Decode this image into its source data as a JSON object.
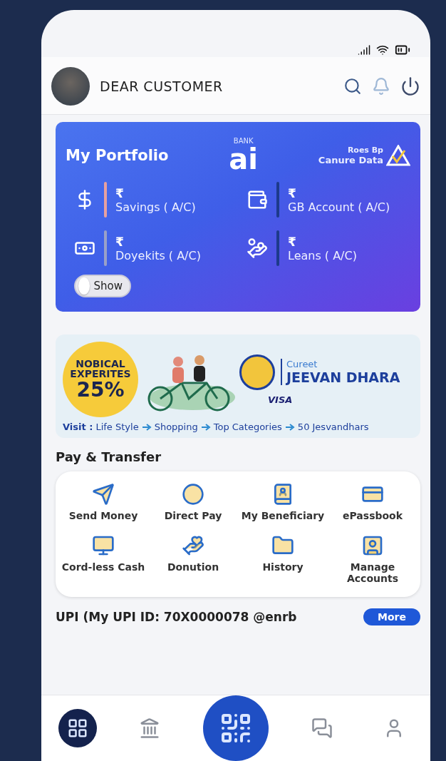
{
  "header": {
    "greeting": "DEAR CUSTOMER"
  },
  "portfolio": {
    "title": "My Portfolio",
    "logo_small": "BANK",
    "logo_main": "ai",
    "partner_line_1": "Roes Bp",
    "partner_line_2": "Canure Data",
    "accounts": [
      {
        "kind": "savings",
        "currency": "₹",
        "label": "Savings ( A/C)"
      },
      {
        "kind": "card",
        "currency": "₹",
        "label": "GB Account ( A/C)"
      },
      {
        "kind": "deposit",
        "currency": "₹",
        "label": "Doyekits ( A/C)"
      },
      {
        "kind": "loan",
        "currency": "₹",
        "label": "Leans ( A/C)"
      }
    ],
    "toggle": {
      "label": "Show",
      "on": false
    }
  },
  "banner": {
    "badge_line_1": "NOBICAL",
    "badge_line_2": "EXPERITES",
    "badge_value": "25%",
    "brand_small": "Cureet",
    "brand_title": "JEEVAN DHARA",
    "partner": "VISA",
    "visit_label": "Visit :",
    "visit_path": [
      "Life Style",
      "Shopping",
      "Top Categories",
      "50 Jesvandhars"
    ]
  },
  "pay_transfer": {
    "title": "Pay & Transfer",
    "items": [
      {
        "kind": "send",
        "label": "Send Money"
      },
      {
        "kind": "direct",
        "label": "Direct Pay"
      },
      {
        "kind": "beneficiary",
        "label": "My Beneficiary"
      },
      {
        "kind": "passbook",
        "label": "ePassbook"
      },
      {
        "kind": "cardless",
        "label": "Cord-less Cash"
      },
      {
        "kind": "donation",
        "label": "Donution"
      },
      {
        "kind": "history",
        "label": "History"
      },
      {
        "kind": "manage",
        "label": "Manage Accounts"
      }
    ]
  },
  "upi": {
    "title": "UPI (My UPI ID: 70X0000078 @enrb",
    "more": "More"
  },
  "bottom_nav": [
    {
      "kind": "apps",
      "selected": true
    },
    {
      "kind": "bank",
      "selected": false
    },
    {
      "kind": "scan",
      "selected": false
    },
    {
      "kind": "chat",
      "selected": false
    },
    {
      "kind": "profile",
      "selected": false
    }
  ]
}
